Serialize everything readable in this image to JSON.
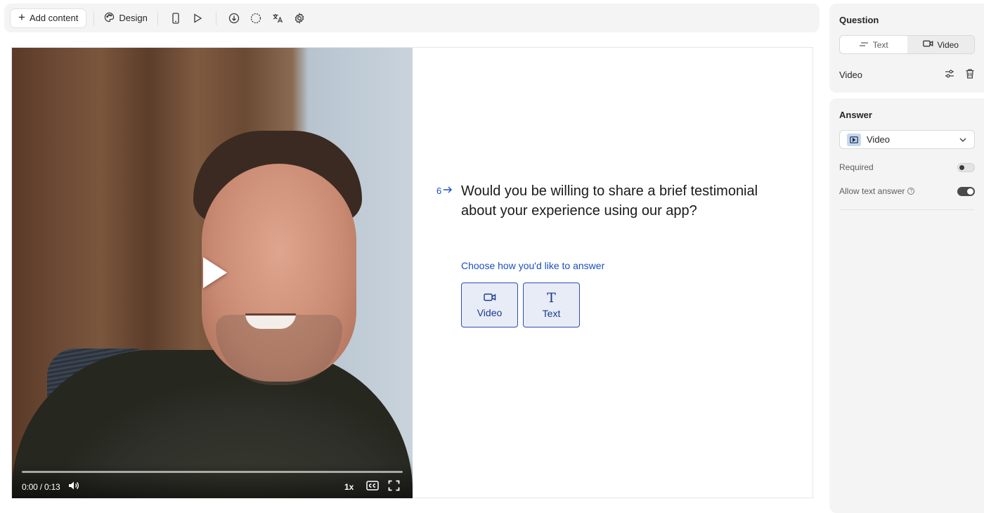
{
  "toolbar": {
    "add_content_label": "Add content",
    "design_label": "Design",
    "icons": [
      "mobile-icon",
      "play-preview-icon",
      "download-icon",
      "logic-icon",
      "translate-icon",
      "settings-icon"
    ]
  },
  "video": {
    "time": "0:00 / 0:13",
    "speed": "1x",
    "progress": 0
  },
  "question": {
    "number": "6",
    "text": "Would you be willing to share a brief testimonial about your experience using our app?",
    "choose_label": "Choose how you'd like to answer",
    "options": [
      {
        "label": "Video",
        "icon": "video-camera-icon"
      },
      {
        "label": "Text",
        "icon": "text-t-icon"
      }
    ]
  },
  "panel": {
    "question_title": "Question",
    "tabs": [
      {
        "label": "Text",
        "icon": "text-lines-icon",
        "active": false
      },
      {
        "label": "Video",
        "icon": "video-camera-icon",
        "active": true
      }
    ],
    "media_label": "Video",
    "answer_title": "Answer",
    "answer_type": "Video",
    "required_label": "Required",
    "required_on": false,
    "allow_text_label": "Allow text answer",
    "allow_text_on": true
  }
}
